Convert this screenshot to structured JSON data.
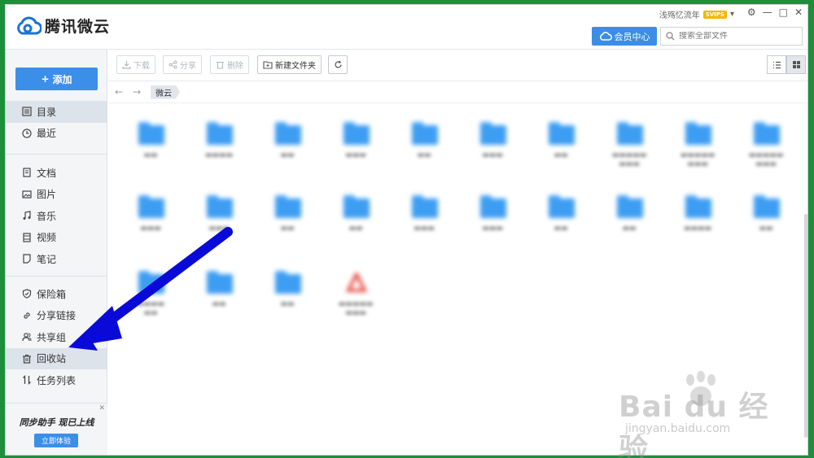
{
  "app": {
    "title": "腾讯微云"
  },
  "user": {
    "name": "浅殇忆流年",
    "badge": "SVIPS"
  },
  "header": {
    "vip_label": "会员中心"
  },
  "search": {
    "placeholder": "搜索全部文件"
  },
  "sidebar": {
    "add_label": "添加",
    "group1": [
      {
        "label": "目录",
        "icon": "list-icon"
      },
      {
        "label": "最近",
        "icon": "clock-icon"
      }
    ],
    "group2": [
      {
        "label": "文档",
        "icon": "document-icon"
      },
      {
        "label": "图片",
        "icon": "image-icon"
      },
      {
        "label": "音乐",
        "icon": "music-icon"
      },
      {
        "label": "视频",
        "icon": "video-icon"
      },
      {
        "label": "笔记",
        "icon": "note-icon"
      }
    ],
    "group3": [
      {
        "label": "保险箱",
        "icon": "shield-icon"
      },
      {
        "label": "分享链接",
        "icon": "link-icon"
      },
      {
        "label": "共享组",
        "icon": "group-icon"
      },
      {
        "label": "回收站",
        "icon": "trash-icon"
      },
      {
        "label": "任务列表",
        "icon": "transfer-icon"
      }
    ],
    "promo": {
      "text": "同步助手 现已上线",
      "button": "立即体验"
    }
  },
  "toolbar": {
    "download": "下载",
    "share": "分享",
    "delete": "删除",
    "new_folder": "新建文件夹"
  },
  "breadcrumb": {
    "current": "微云"
  },
  "colors": {
    "accent": "#3b8fe8",
    "folder": "#3d9df2",
    "arrow": "#0a0ad8"
  },
  "watermark": {
    "main": "Bai du 经验",
    "sub": "jingyan.baidu.com"
  }
}
